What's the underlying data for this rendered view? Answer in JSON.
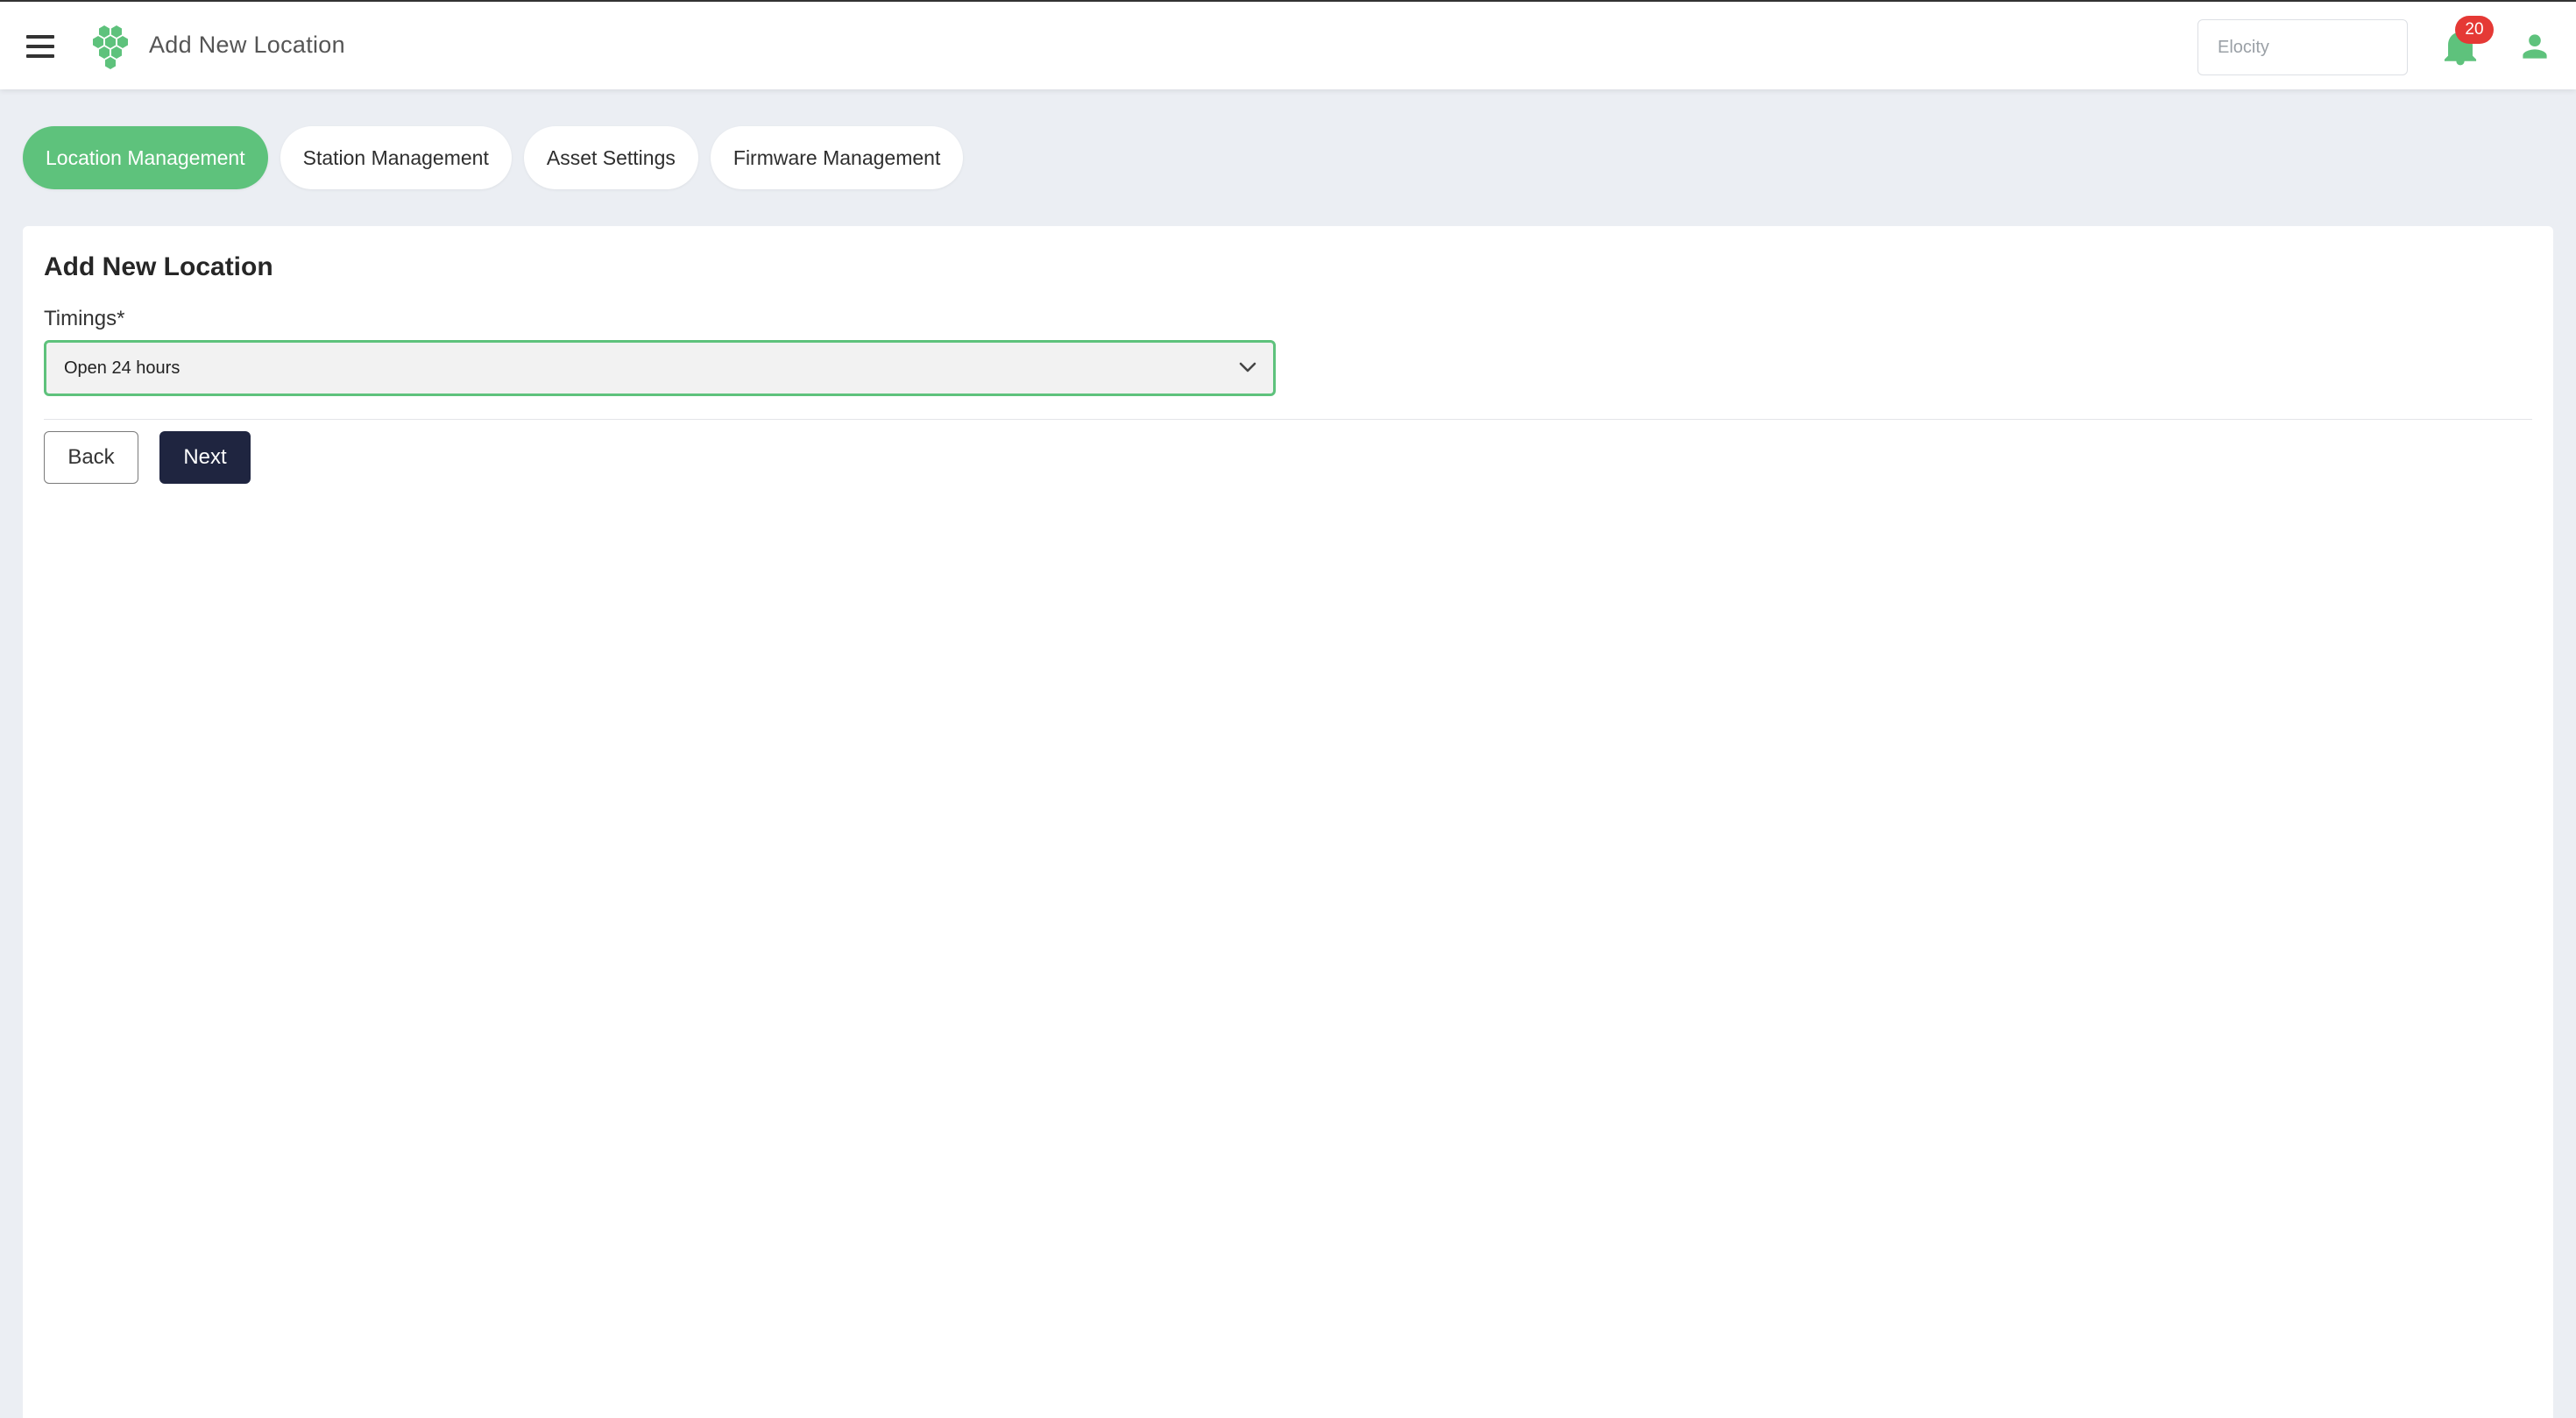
{
  "header": {
    "title": "Add New Location",
    "org_placeholder": "Elocity",
    "notification_count": "20",
    "brand_color": "#5ec27c",
    "icons": {
      "menu": "hamburger-menu-icon",
      "logo": "hexagon-cluster-logo",
      "bell": "bell-icon",
      "user": "user-icon"
    }
  },
  "tabs": [
    {
      "label": "Location Management",
      "active": true
    },
    {
      "label": "Station Management",
      "active": false
    },
    {
      "label": "Asset Settings",
      "active": false
    },
    {
      "label": "Firmware Management",
      "active": false
    }
  ],
  "form": {
    "title": "Add New Location",
    "timings_label": "Timings*",
    "timings_value": "Open 24 hours",
    "back_label": "Back",
    "next_label": "Next",
    "next_color": "#1f2540"
  }
}
